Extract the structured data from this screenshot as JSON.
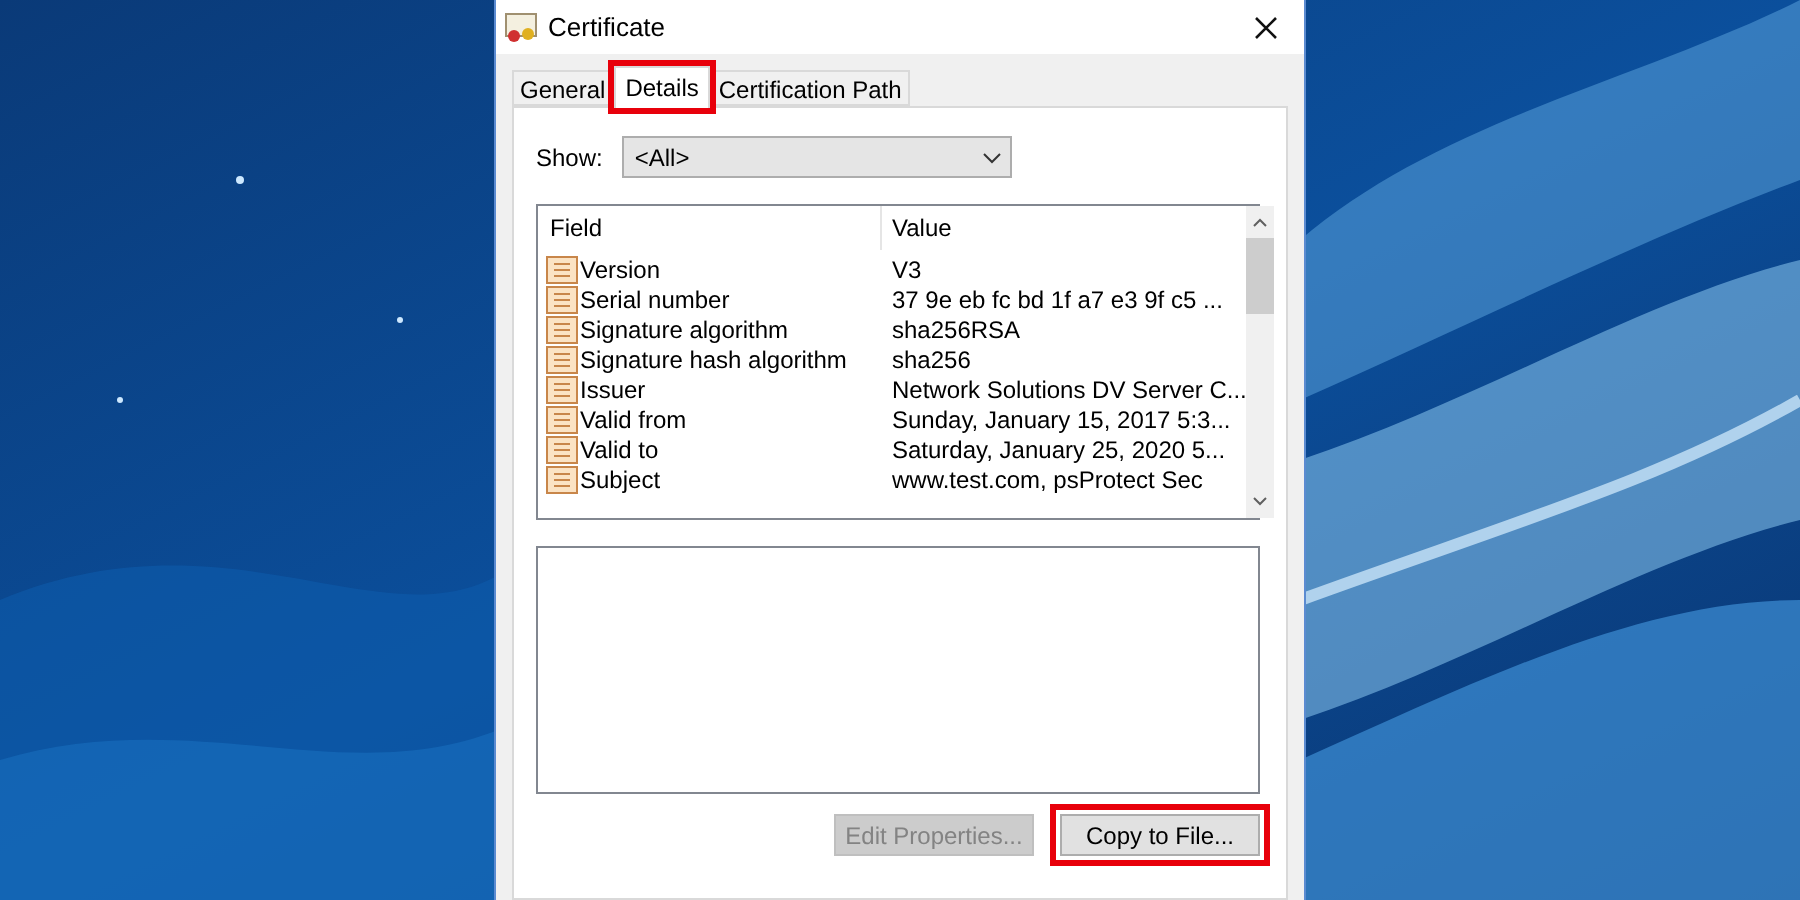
{
  "window": {
    "title": "Certificate"
  },
  "tabs": [
    {
      "label": "General",
      "selected": false,
      "highlighted": false
    },
    {
      "label": "Details",
      "selected": true,
      "highlighted": true
    },
    {
      "label": "Certification Path",
      "selected": false,
      "highlighted": false
    }
  ],
  "show": {
    "label": "Show:",
    "value": "<All>"
  },
  "table": {
    "columns": [
      "Field",
      "Value"
    ],
    "rows": [
      {
        "field": "Version",
        "value": "V3"
      },
      {
        "field": "Serial number",
        "value": "37 9e eb fc bd 1f a7 e3 9f c5 ..."
      },
      {
        "field": "Signature algorithm",
        "value": "sha256RSA"
      },
      {
        "field": "Signature hash algorithm",
        "value": "sha256"
      },
      {
        "field": "Issuer",
        "value": "Network Solutions DV Server C..."
      },
      {
        "field": "Valid from",
        "value": "Sunday, January 15, 2017 5:3..."
      },
      {
        "field": "Valid to",
        "value": "Saturday, January 25, 2020 5..."
      },
      {
        "field": "Subject",
        "value": "www.test.com, psProtect Sec"
      }
    ]
  },
  "buttons": [
    {
      "label": "Edit Properties...",
      "disabled": true,
      "highlighted": false
    },
    {
      "label": "Copy to File...",
      "disabled": false,
      "highlighted": true
    }
  ]
}
